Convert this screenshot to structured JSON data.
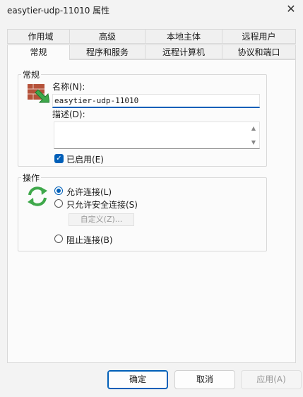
{
  "window": {
    "title": "easytier-udp-11010 属性"
  },
  "tabs": {
    "row1": [
      "作用域",
      "高级",
      "本地主体",
      "远程用户"
    ],
    "row2": [
      "常规",
      "程序和服务",
      "远程计算机",
      "协议和端口"
    ]
  },
  "general": {
    "group_title": "常规",
    "name_label": "名称(N):",
    "name_value": "easytier-udp-11010",
    "description_label": "描述(D):",
    "description_value": "",
    "enabled_label": "已启用(E)"
  },
  "action": {
    "group_title": "操作",
    "allow_label": "允许连接(L)",
    "allow_secure_label": "只允许安全连接(S)",
    "customize_label": "自定义(Z)...",
    "block_label": "阻止连接(B)"
  },
  "buttons": {
    "ok": "确定",
    "cancel": "取消",
    "apply": "应用(A)"
  },
  "colors": {
    "accent": "#005fb8",
    "brick": "#b5523a",
    "arrow_green": "#3fa84b"
  }
}
